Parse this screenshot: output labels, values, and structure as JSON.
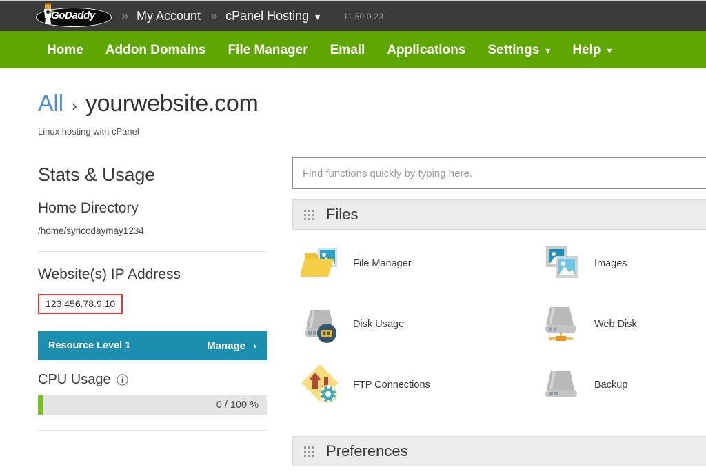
{
  "topbar": {
    "logo_text": "GoDaddy",
    "logo_icon": "godaddy-mascot-logo",
    "separator": "»",
    "my_account_label": "My Account",
    "hosting_label": "cPanel Hosting",
    "hosting_caret_icon": "chevron-down-icon",
    "version": "11.50.0.23",
    "bg_color": "#3b3b3b"
  },
  "nav": {
    "bg_color": "#5ea700",
    "items": [
      {
        "label": "Home",
        "caret": false
      },
      {
        "label": "Addon Domains",
        "caret": false
      },
      {
        "label": "File Manager",
        "caret": false
      },
      {
        "label": "Email",
        "caret": false
      },
      {
        "label": "Applications",
        "caret": false
      },
      {
        "label": "Settings",
        "caret": true
      },
      {
        "label": "Help",
        "caret": true
      }
    ],
    "caret_icon": "chevron-down-icon"
  },
  "breadcrumb": {
    "all_label": "All",
    "arrow": "›",
    "site_label": "yourwebsite.com",
    "subtitle": "Linux hosting with cPanel",
    "link_color": "#4b8fd6"
  },
  "sidebar": {
    "title": "Stats & Usage",
    "home_directory": {
      "label": "Home Directory",
      "value": "/home/syncodaymay1234"
    },
    "ip": {
      "label": "Website(s) IP Address",
      "value": "123.456.78.9.10",
      "highlight_color": "#e23a30"
    },
    "resource": {
      "level_label": "Resource Level 1",
      "manage_label": "Manage",
      "chevron_icon": "chevron-right-icon",
      "bg_color": "#1b8fb0"
    },
    "cpu": {
      "label": "CPU Usage",
      "info_icon": "info-circle-icon",
      "value_text": "0 / 100 %",
      "percent": 0,
      "fill_color": "#76c514"
    }
  },
  "search": {
    "placeholder": "Find functions quickly by typing here.",
    "value": ""
  },
  "panels": [
    {
      "title": "Files",
      "grip_icon": "drag-grip-icon"
    },
    {
      "title": "Preferences",
      "grip_icon": "drag-grip-icon"
    }
  ],
  "files_tiles": [
    {
      "label": "File Manager",
      "icon": "folder-image-icon"
    },
    {
      "label": "Images",
      "icon": "images-stack-icon"
    },
    {
      "label": "Disk Usage",
      "icon": "disk-usage-icon"
    },
    {
      "label": "Web Disk",
      "icon": "web-disk-icon"
    },
    {
      "label": "FTP Connections",
      "icon": "ftp-connections-icon"
    },
    {
      "label": "Backup",
      "icon": "backup-drive-icon"
    }
  ]
}
